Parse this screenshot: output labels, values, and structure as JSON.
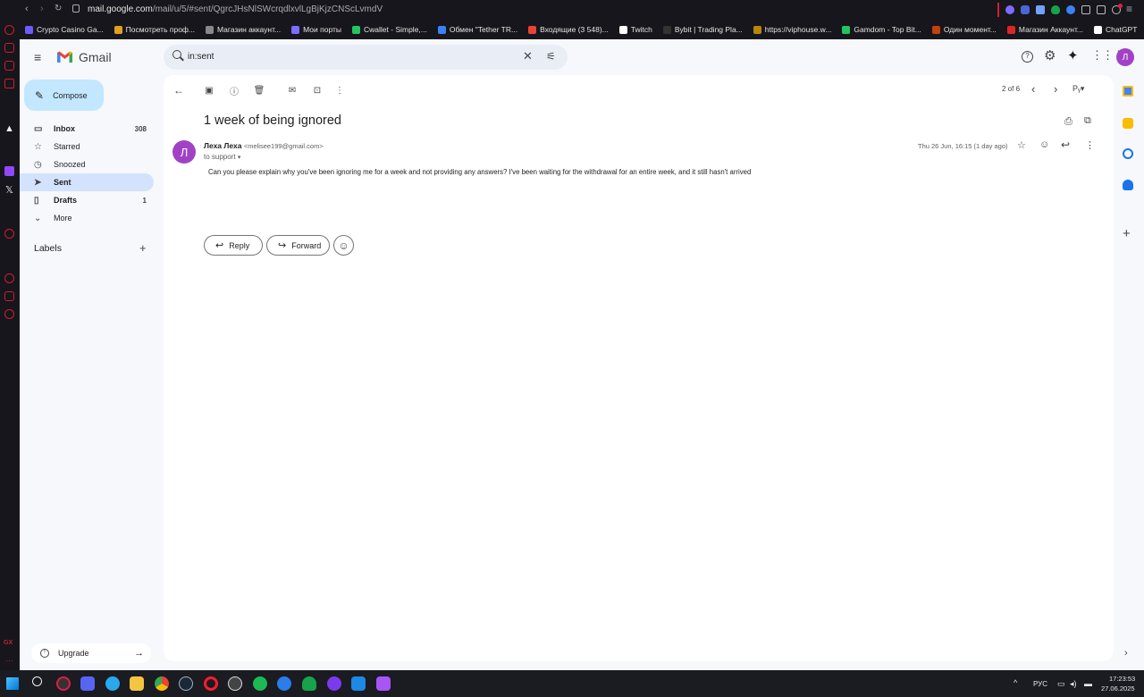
{
  "browser": {
    "url_host": "mail.google.com",
    "url_path": "/mail/u/5/#sent/QgrcJHsNlSWcrqdlxvlLgBjKjzCNScLvmdV"
  },
  "bookmarks": [
    {
      "label": "Crypto Casino Ga...",
      "color": "#6b5cff"
    },
    {
      "label": "Посмотреть проф...",
      "color": "#e0a020"
    },
    {
      "label": "Магазин аккаунт...",
      "color": "#888888"
    },
    {
      "label": "Мои порты",
      "color": "#7c6cff"
    },
    {
      "label": "Cwallet - Simple,...",
      "color": "#22c55e"
    },
    {
      "label": "Обмен \"Tether TR...",
      "color": "#3b82f6"
    },
    {
      "label": "Входящие (3 548)...",
      "color": "#ea4335"
    },
    {
      "label": "Twitch",
      "color": "#ffffff"
    },
    {
      "label": "Bybit | Trading Pla...",
      "color": "#333333"
    },
    {
      "label": "https://viphouse.w...",
      "color": "#b8860b"
    },
    {
      "label": "Gamdom - Top Bit...",
      "color": "#22c55e"
    },
    {
      "label": "Один момент...",
      "color": "#c2410c"
    },
    {
      "label": "Магазин Аккаунт...",
      "color": "#dc2626"
    },
    {
      "label": "ChatGPT",
      "color": "#ffffff"
    }
  ],
  "gmail": {
    "logo_text": "Gmail",
    "search_value": "in:sent",
    "avatar_letter": "Л",
    "compose_label": "Compose",
    "nav": [
      {
        "label": "Inbox",
        "count": "308",
        "icon": "inbox-icon"
      },
      {
        "label": "Starred",
        "count": "",
        "icon": "star-icon"
      },
      {
        "label": "Snoozed",
        "count": "",
        "icon": "clock-icon"
      },
      {
        "label": "Sent",
        "count": "",
        "icon": "send-icon"
      },
      {
        "label": "Drafts",
        "count": "1",
        "icon": "draft-icon"
      },
      {
        "label": "More",
        "count": "",
        "icon": "chevron-down-icon"
      }
    ],
    "labels_title": "Labels",
    "upgrade_label": "Upgrade",
    "pagination": "2 of 6",
    "email": {
      "subject": "1 week of being ignored",
      "sender_name": "Леха Леха",
      "sender_email": "<melisee199@gmail.com>",
      "to_line": "to support",
      "date": "Thu 26 Jun, 16:15 (1 day ago)",
      "sender_initial": "Л",
      "body": "Can you please explain why you've been ignoring me for a week and not providing any answers? I've been waiting for the withdrawal for an entire week, and it still hasn't arrived"
    },
    "reply_label": "Reply",
    "forward_label": "Forward"
  },
  "taskbar": {
    "lang": "РУС",
    "time": "17:23:53",
    "date": "27.06.2025"
  },
  "colors": {
    "accent": "#0b57d0",
    "compose_bg": "#c2e7ff",
    "sent_selected": "#d3e3fd",
    "avatar": "#a142c6"
  }
}
